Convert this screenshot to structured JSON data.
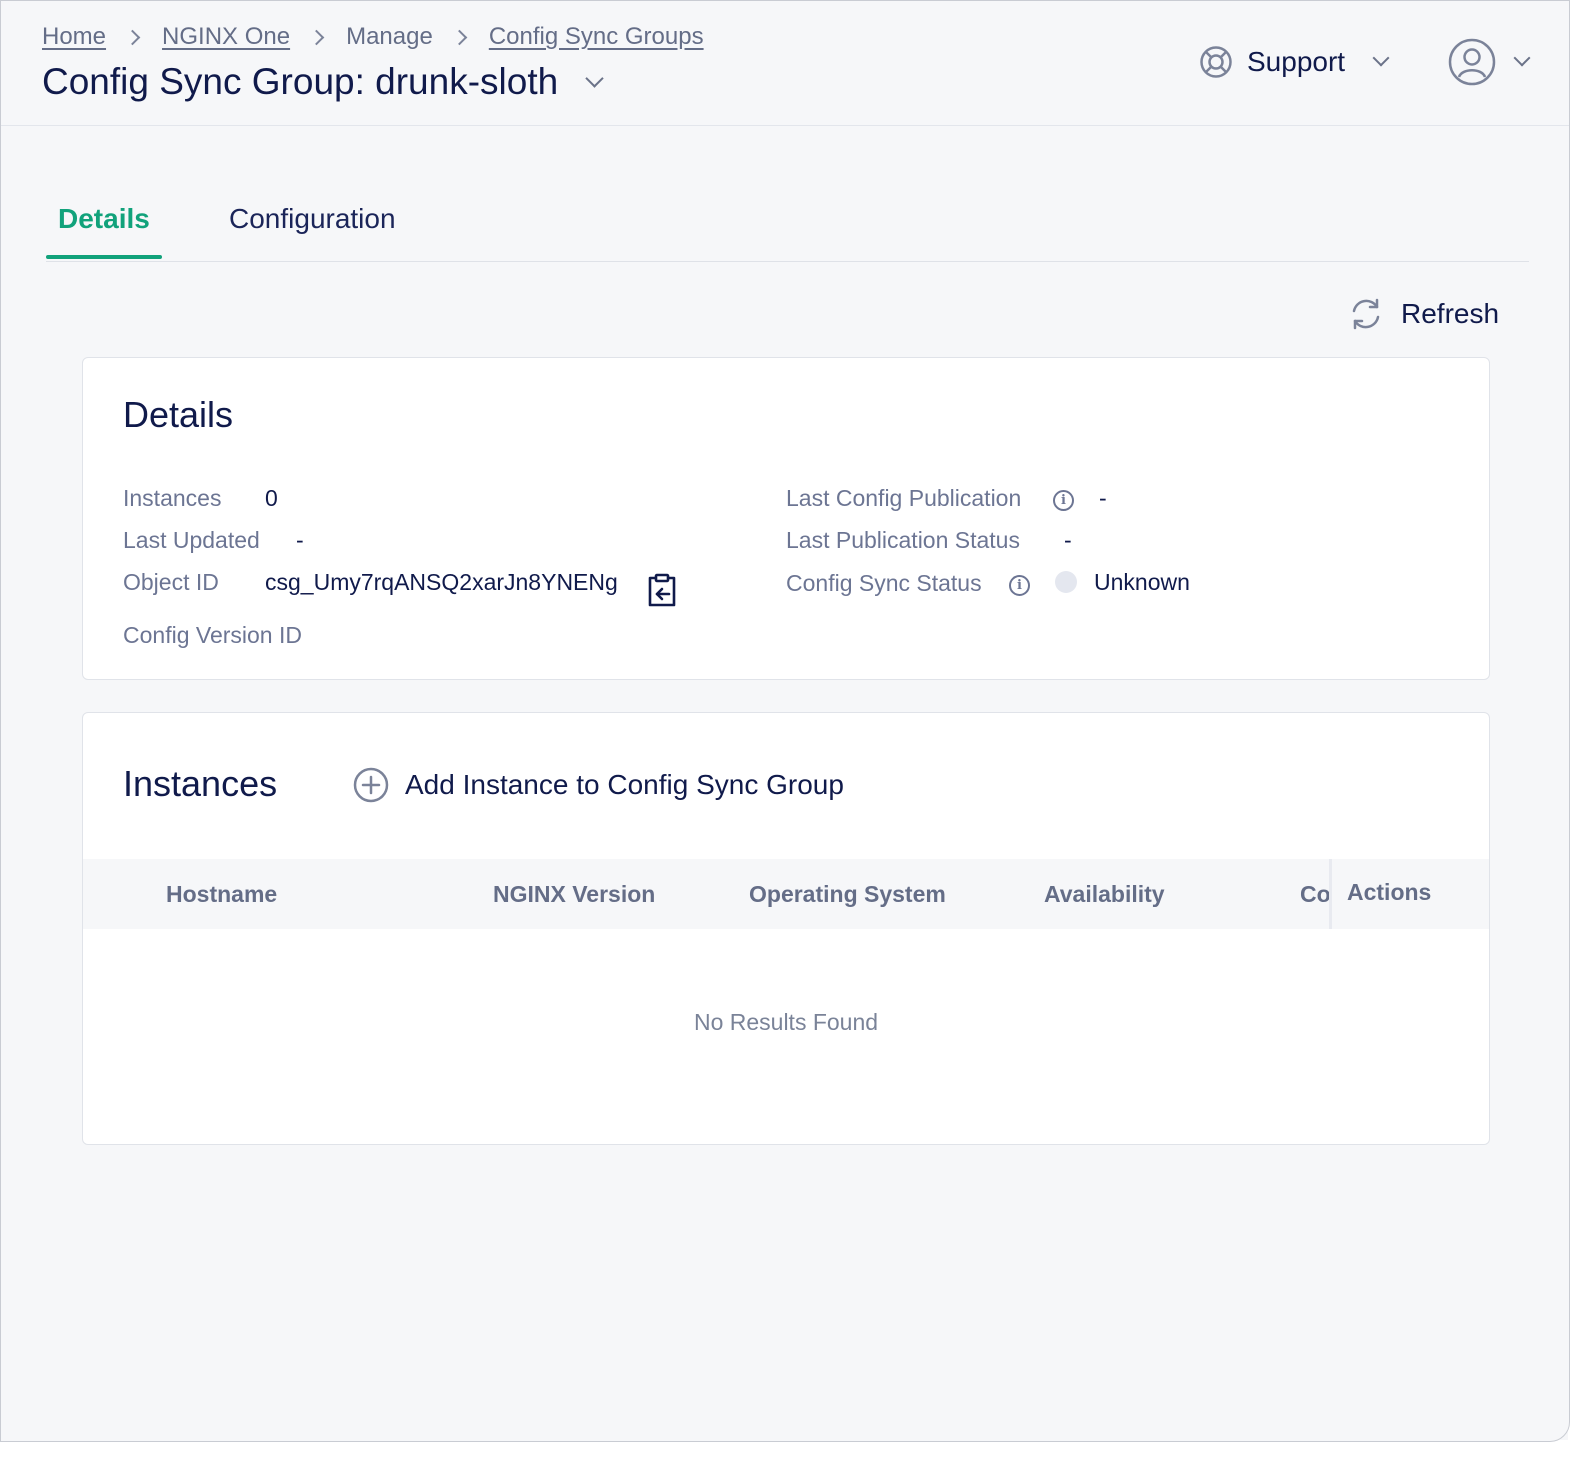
{
  "breadcrumb": {
    "items": [
      {
        "label": "Home",
        "link": true
      },
      {
        "label": "NGINX One",
        "link": true
      },
      {
        "label": "Manage",
        "link": false
      },
      {
        "label": "Config Sync Groups",
        "link": true
      }
    ]
  },
  "page_title": "Config Sync Group: drunk-sloth",
  "header": {
    "support_label": "Support"
  },
  "tabs": [
    {
      "label": "Details",
      "active": true
    },
    {
      "label": "Configuration",
      "active": false
    }
  ],
  "toolbar": {
    "refresh_label": "Refresh"
  },
  "details": {
    "title": "Details",
    "instances_label": "Instances",
    "instances_value": "0",
    "last_updated_label": "Last Updated",
    "last_updated_value": "-",
    "object_id_label": "Object ID",
    "object_id_value": "csg_Umy7rqANSQ2xarJn8YNENg",
    "config_version_label": "Config Version ID",
    "last_config_publication_label": "Last Config Publication",
    "last_config_publication_value": "-",
    "last_publication_status_label": "Last Publication Status",
    "last_publication_status_value": "-",
    "config_sync_status_label": "Config Sync Status",
    "config_sync_status_value": "Unknown"
  },
  "instances": {
    "title": "Instances",
    "add_label": "Add Instance to Config Sync Group",
    "columns": [
      "Hostname",
      "NGINX Version",
      "Operating System",
      "Availability",
      "Co",
      "Actions"
    ],
    "empty_text": "No Results Found"
  },
  "colors": {
    "accent": "#11a27b",
    "text_primary": "#101a4b",
    "text_muted": "#6c7593"
  }
}
